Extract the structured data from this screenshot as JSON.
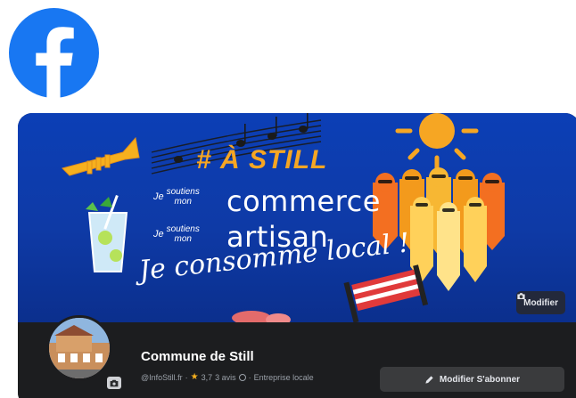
{
  "brand": {
    "logo_icon": "facebook-logo-icon",
    "color": "#1877F2"
  },
  "cover": {
    "hashtag": "# À STILL",
    "line1_small_top": "Je",
    "line1_small_mid": "soutiens",
    "line1_small_bot": "mon",
    "line1_big": "commerce",
    "line2_small_top": "Je",
    "line2_small_mid": "soutiens",
    "line2_small_bot": "mon",
    "line2_big": "artisan",
    "script": "Je consomme local !",
    "edit_label": "Modifier",
    "colors": {
      "background": "#0C3FB6",
      "accent": "#F6A623"
    }
  },
  "profile": {
    "name": "Commune de Still",
    "handle": "@InfoStill.fr",
    "rating": "3,7",
    "reviews": "3 avis",
    "category": "Entreprise locale",
    "subscribe_label": "Modifier S'abonner"
  }
}
